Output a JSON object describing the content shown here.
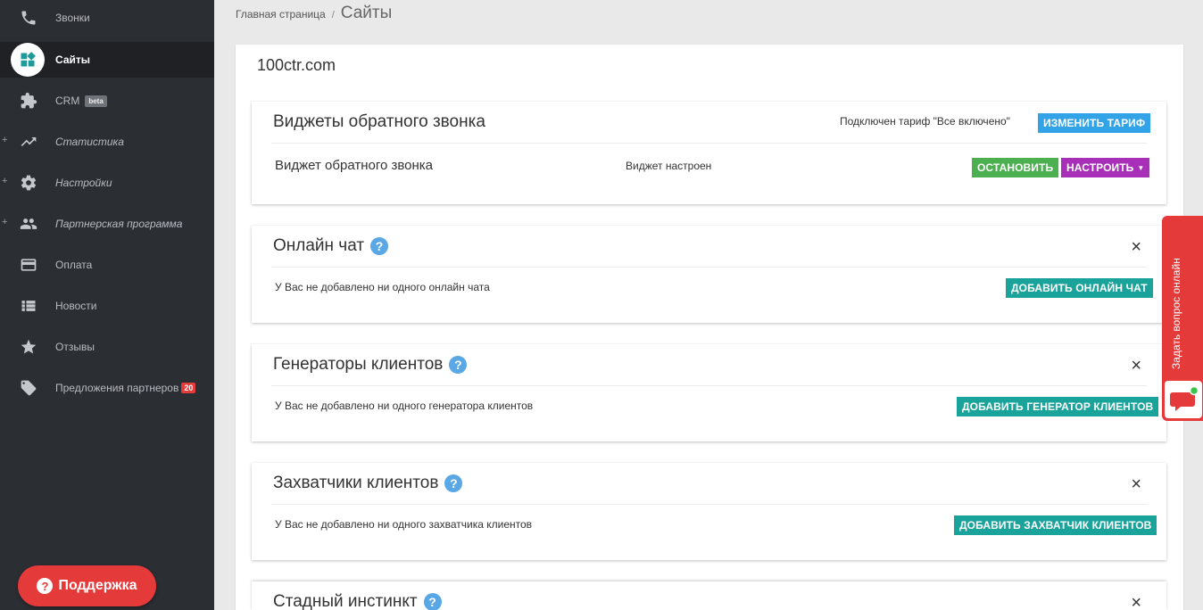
{
  "sidebar": {
    "items": [
      {
        "label": "Звонки",
        "icon": "phone-icon"
      },
      {
        "label": "Сайты",
        "icon": "dashboard-icon",
        "active": true
      },
      {
        "label": "CRM",
        "icon": "puzzle-icon",
        "badge": "beta"
      },
      {
        "label": "Статистика",
        "icon": "trending-up-icon",
        "expandable": "+"
      },
      {
        "label": "Настройки",
        "icon": "gear-icon",
        "expandable": "+"
      },
      {
        "label": "Партнерская программа",
        "icon": "people-icon",
        "expandable": "+"
      },
      {
        "label": "Оплата",
        "icon": "credit-card-icon"
      },
      {
        "label": "Новости",
        "icon": "list-icon"
      },
      {
        "label": "Отзывы",
        "icon": "star-icon"
      },
      {
        "label": "Предложения партнеров",
        "icon": "tag-icon",
        "count": "20"
      }
    ],
    "support_label": "Поддержка"
  },
  "breadcrumb": {
    "home": "Главная страница",
    "separator": "/",
    "current": "Сайты"
  },
  "site": {
    "title": "100ctr.com"
  },
  "callback": {
    "title": "Виджеты обратного звонка",
    "tariff_text": "Подключен тариф \"Все включено\"",
    "change_tariff_button": "ИЗМЕНИТЬ ТАРИФ",
    "widget_name": "Виджет обратного звонка",
    "widget_status": "Виджет настроен",
    "stop_button": "ОСТАНОВИТЬ",
    "configure_button": "НАСТРОИТЬ"
  },
  "online_chat": {
    "title": "Онлайн чат",
    "empty_text": "У Вас не добавлено ни одного онлайн чата",
    "add_button": "ДОБАВИТЬ ОНЛАЙН ЧАТ"
  },
  "generators": {
    "title": "Генераторы клиентов",
    "empty_text": "У Вас не добавлено ни одного генератора клиентов",
    "add_button": "ДОБАВИТЬ ГЕНЕРАТОР КЛИЕНТОВ"
  },
  "catchers": {
    "title": "Захватчики клиентов",
    "empty_text": "У Вас не добавлено ни одного захватчика клиентов",
    "add_button": "ДОБАВИТЬ ЗАХВАТЧИК КЛИЕНТОВ"
  },
  "herd": {
    "title": "Стадный инстинкт"
  },
  "feedback_widget": {
    "label": "Задать вопрос онлайн"
  },
  "colors": {
    "sidebar_bg": "#2b2e33",
    "teal": "#1aa39b",
    "blue": "#33a3e8",
    "green": "#4caf50",
    "purple": "#a82fb8",
    "red": "#e53a3a"
  }
}
